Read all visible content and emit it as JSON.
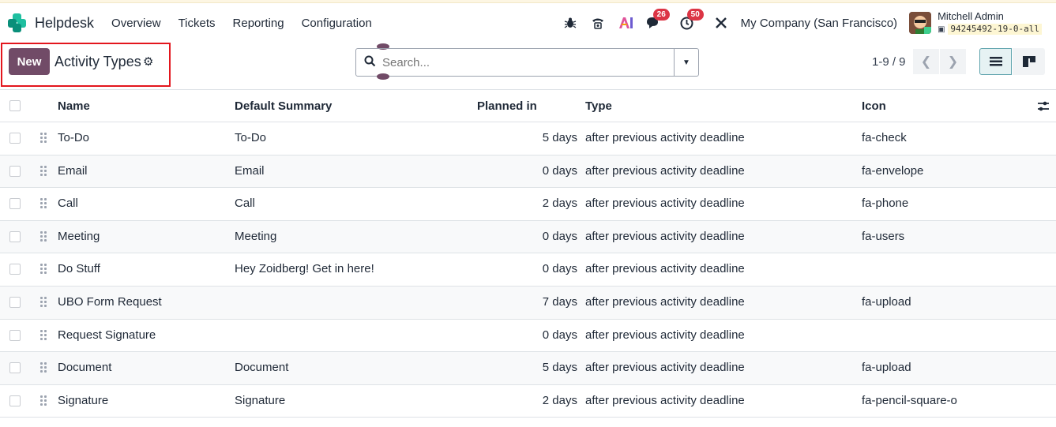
{
  "navbar": {
    "app_name": "Helpdesk",
    "menu": [
      "Overview",
      "Tickets",
      "Reporting",
      "Configuration"
    ],
    "messages_count": "26",
    "activities_count": "50",
    "company": "My Company (San Francisco)",
    "user_name": "Mitchell Admin",
    "db_name": "94245492-19-0-all"
  },
  "control": {
    "new_label": "New",
    "title": "Activity Types",
    "search_placeholder": "Search...",
    "pager": "1-9 / 9"
  },
  "columns": {
    "name": "Name",
    "summary": "Default Summary",
    "planned": "Planned in",
    "type": "Type",
    "icon": "Icon"
  },
  "rows": [
    {
      "name": "To-Do",
      "summary": "To-Do",
      "planned": "5 days",
      "type": "after previous activity deadline",
      "icon": "fa-check"
    },
    {
      "name": "Email",
      "summary": "Email",
      "planned": "0 days",
      "type": "after previous activity deadline",
      "icon": "fa-envelope"
    },
    {
      "name": "Call",
      "summary": "Call",
      "planned": "2 days",
      "type": "after previous activity deadline",
      "icon": "fa-phone"
    },
    {
      "name": "Meeting",
      "summary": "Meeting",
      "planned": "0 days",
      "type": "after previous activity deadline",
      "icon": "fa-users"
    },
    {
      "name": "Do Stuff",
      "summary": "Hey Zoidberg! Get in here!",
      "planned": "0 days",
      "type": "after previous activity deadline",
      "icon": ""
    },
    {
      "name": "UBO Form Request",
      "summary": "",
      "planned": "7 days",
      "type": "after previous activity deadline",
      "icon": "fa-upload"
    },
    {
      "name": "Request Signature",
      "summary": "",
      "planned": "0 days",
      "type": "after previous activity deadline",
      "icon": ""
    },
    {
      "name": "Document",
      "summary": "Document",
      "planned": "5 days",
      "type": "after previous activity deadline",
      "icon": "fa-upload"
    },
    {
      "name": "Signature",
      "summary": "Signature",
      "planned": "2 days",
      "type": "after previous activity deadline",
      "icon": "fa-pencil-square-o"
    }
  ],
  "colors": {
    "brand": "#714b67",
    "badge": "#dc3545",
    "highlight": "#e3161d"
  }
}
